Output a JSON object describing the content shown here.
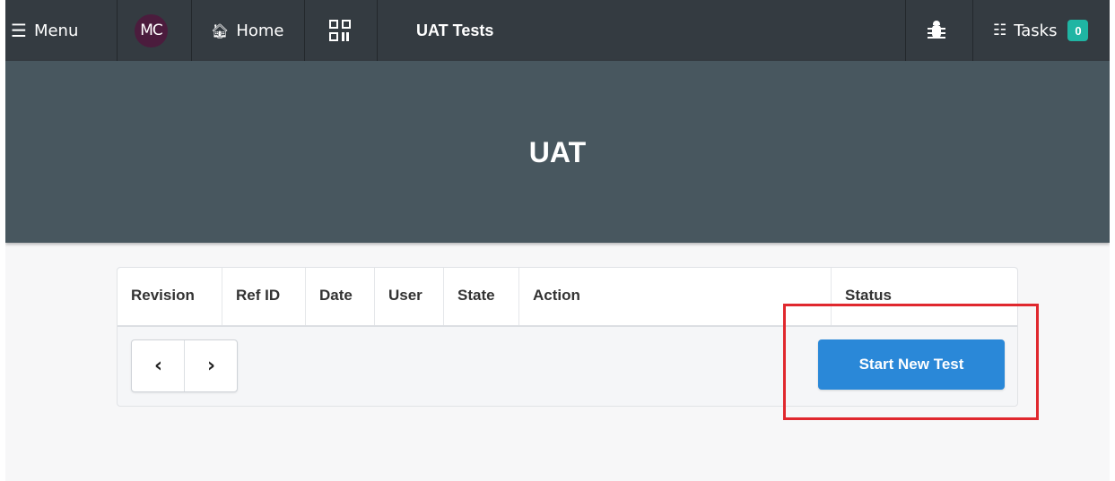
{
  "nav": {
    "menu_label": "Menu",
    "avatar_initials": "MC",
    "home_label": "Home",
    "page_title": "UAT Tests",
    "tasks_label": "Tasks",
    "tasks_count": "0",
    "icons": [
      "hamburger-icon",
      "home-icon",
      "qr-code-icon",
      "bug-icon",
      "tasks-icon"
    ]
  },
  "banner": {
    "title": "UAT"
  },
  "table": {
    "columns": [
      "Revision",
      "Ref ID",
      "Date",
      "User",
      "State",
      "Action",
      "Status"
    ]
  },
  "pager": {
    "prev": "‹",
    "next": "›"
  },
  "actions": {
    "start_new_test": "Start New Test"
  },
  "colors": {
    "nav_bg": "#343b41",
    "banner_bg": "#48575f",
    "primary_button": "#2a88d8",
    "badge": "#1fb5a3",
    "highlight": "#e0282e"
  }
}
